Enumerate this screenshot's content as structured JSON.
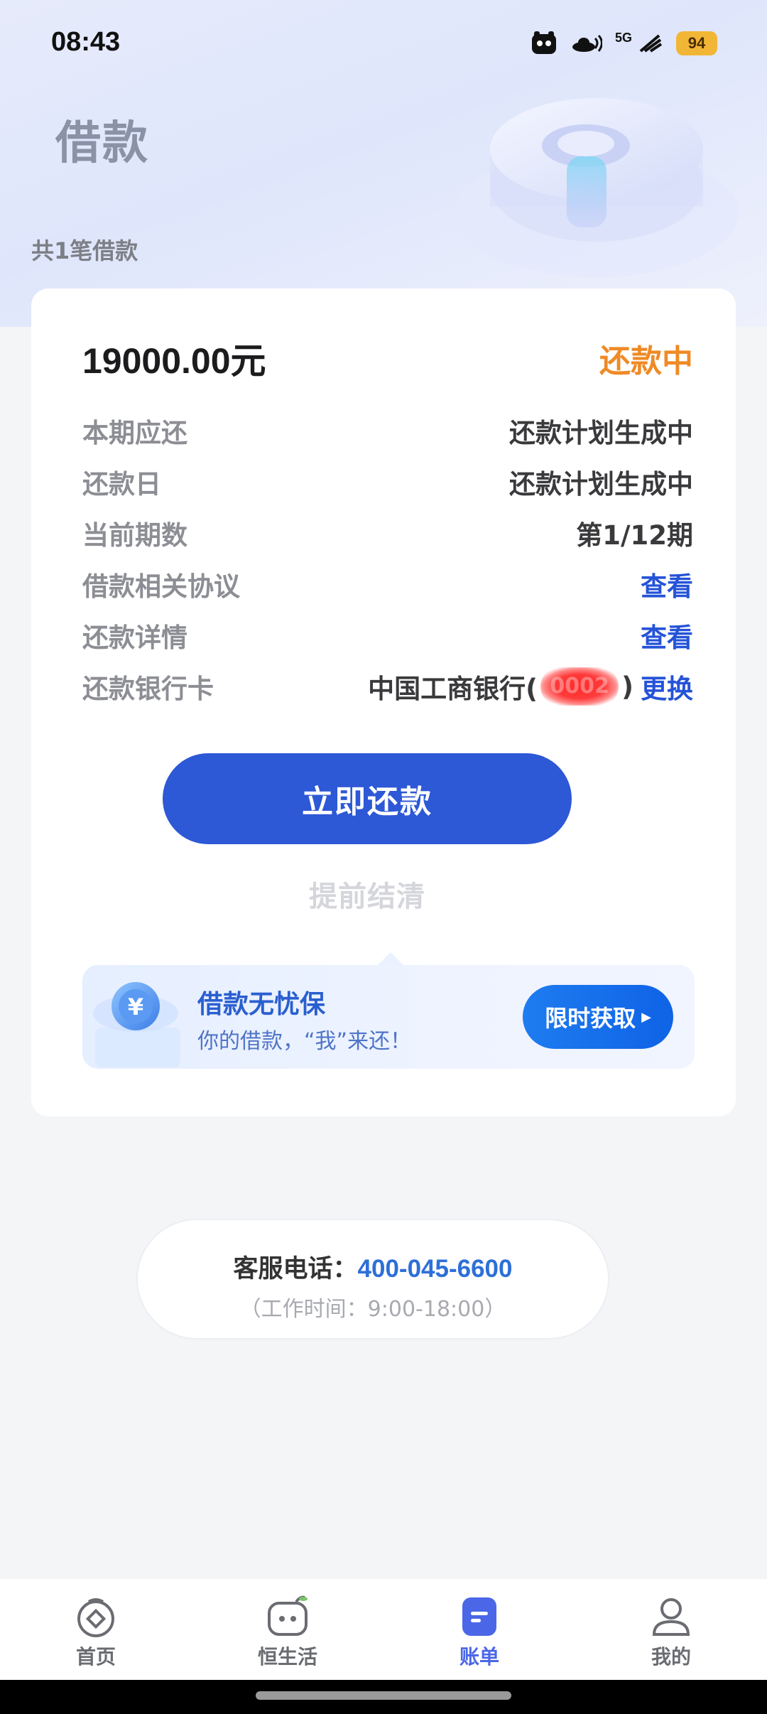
{
  "status_bar": {
    "time": "08:43",
    "network": "5G",
    "battery": "94",
    "icons": [
      "app-notification-icon",
      "hotspot-icon",
      "signal-icon",
      "battery-icon"
    ]
  },
  "page": {
    "title": "借款",
    "loan_count": "共1笔借款"
  },
  "loan_card": {
    "amount": "19000.00元",
    "status": "还款中",
    "rows": [
      {
        "label": "本期应还",
        "value": "还款计划生成中"
      },
      {
        "label": "还款日",
        "value": "还款计划生成中"
      },
      {
        "label": "当前期数",
        "value": "第1/12期"
      },
      {
        "label": "借款相关协议",
        "value": "查看"
      },
      {
        "label": "还款详情",
        "value": "查看"
      },
      {
        "label": "还款银行卡",
        "value": "中国工商银行(",
        "masked": "0002",
        "value_end": ")",
        "action": "更换"
      }
    ],
    "primary_button": "立即还款",
    "secondary_button": "提前结清"
  },
  "promo": {
    "title": "借款无忧保",
    "subtitle": "你的借款，“我”来还！",
    "button": "限时获取",
    "icon": "yen-coin-icon"
  },
  "service": {
    "label": "客服电话：",
    "phone": "400-045-6600",
    "hours": "（工作时间：9:00-18:00）"
  },
  "tabs": [
    {
      "label": "首页",
      "icon": "home-icon",
      "active": false
    },
    {
      "label": "恒生活",
      "icon": "life-icon",
      "active": false
    },
    {
      "label": "账单",
      "icon": "bill-icon",
      "active": true
    },
    {
      "label": "我的",
      "icon": "profile-icon",
      "active": false
    }
  ],
  "colors": {
    "primary": "#2d58d6",
    "status_orange": "#ef8a25",
    "link_blue": "#2553d8",
    "active_tab": "#4b67e8"
  }
}
